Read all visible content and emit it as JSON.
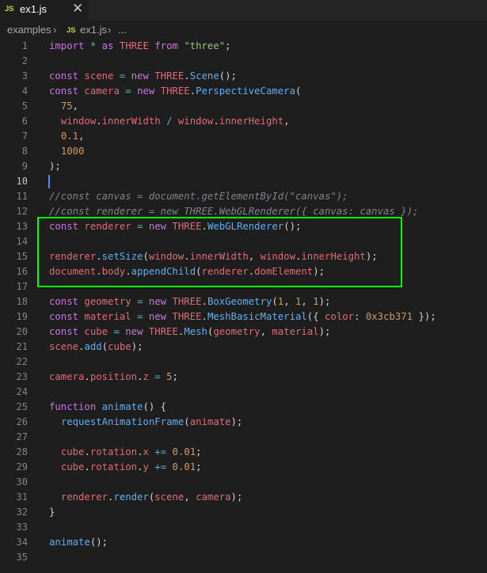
{
  "tab": {
    "icon_label": "JS",
    "filename": "ex1.js",
    "close_glyph": "✕"
  },
  "breadcrumb": {
    "folder": "examples",
    "sep": "›",
    "icon_label": "JS",
    "file": "ex1.js",
    "more": "..."
  },
  "highlight_color": "#00ff00",
  "active_line": 10,
  "lines": [
    {
      "n": "1",
      "tokens": [
        [
          "k",
          "import "
        ],
        [
          "o",
          "* "
        ],
        [
          "k",
          "as "
        ],
        [
          "v",
          "THREE "
        ],
        [
          "k",
          "from "
        ],
        [
          "s",
          "\"three\""
        ],
        [
          "p",
          ";"
        ]
      ]
    },
    {
      "n": "2",
      "tokens": []
    },
    {
      "n": "3",
      "tokens": [
        [
          "k",
          "const "
        ],
        [
          "v",
          "scene "
        ],
        [
          "o",
          "= "
        ],
        [
          "k",
          "new "
        ],
        [
          "v",
          "THREE"
        ],
        [
          "p",
          "."
        ],
        [
          "f",
          "Scene"
        ],
        [
          "p",
          "();"
        ]
      ]
    },
    {
      "n": "4",
      "tokens": [
        [
          "k",
          "const "
        ],
        [
          "v",
          "camera "
        ],
        [
          "o",
          "= "
        ],
        [
          "k",
          "new "
        ],
        [
          "v",
          "THREE"
        ],
        [
          "p",
          "."
        ],
        [
          "f",
          "PerspectiveCamera"
        ],
        [
          "p",
          "("
        ]
      ]
    },
    {
      "n": "5",
      "tokens": [
        [
          "p",
          "  "
        ],
        [
          "n",
          "75"
        ],
        [
          "p",
          ","
        ]
      ]
    },
    {
      "n": "6",
      "tokens": [
        [
          "p",
          "  "
        ],
        [
          "v",
          "window"
        ],
        [
          "p",
          "."
        ],
        [
          "v",
          "innerWidth "
        ],
        [
          "o",
          "/ "
        ],
        [
          "v",
          "window"
        ],
        [
          "p",
          "."
        ],
        [
          "v",
          "innerHeight"
        ],
        [
          "p",
          ","
        ]
      ]
    },
    {
      "n": "7",
      "tokens": [
        [
          "p",
          "  "
        ],
        [
          "n",
          "0.1"
        ],
        [
          "p",
          ","
        ]
      ]
    },
    {
      "n": "8",
      "tokens": [
        [
          "p",
          "  "
        ],
        [
          "n",
          "1000"
        ]
      ]
    },
    {
      "n": "9",
      "tokens": [
        [
          "p",
          ");"
        ]
      ]
    },
    {
      "n": "10",
      "tokens": []
    },
    {
      "n": "11",
      "tokens": [
        [
          "c",
          "//const canvas = document.getElementById(\"canvas\");"
        ]
      ]
    },
    {
      "n": "12",
      "tokens": [
        [
          "c",
          "//const renderer = new THREE.WebGLRenderer({ canvas: canvas });"
        ]
      ]
    },
    {
      "n": "13",
      "tokens": [
        [
          "k",
          "const "
        ],
        [
          "v",
          "renderer "
        ],
        [
          "o",
          "= "
        ],
        [
          "k",
          "new "
        ],
        [
          "v",
          "THREE"
        ],
        [
          "p",
          "."
        ],
        [
          "f",
          "WebGLRenderer"
        ],
        [
          "p",
          "();"
        ]
      ]
    },
    {
      "n": "14",
      "tokens": []
    },
    {
      "n": "15",
      "tokens": [
        [
          "v",
          "renderer"
        ],
        [
          "p",
          "."
        ],
        [
          "f",
          "setSize"
        ],
        [
          "p",
          "("
        ],
        [
          "v",
          "window"
        ],
        [
          "p",
          "."
        ],
        [
          "v",
          "innerWidth"
        ],
        [
          "p",
          ", "
        ],
        [
          "v",
          "window"
        ],
        [
          "p",
          "."
        ],
        [
          "v",
          "innerHeight"
        ],
        [
          "p",
          ");"
        ]
      ]
    },
    {
      "n": "16",
      "tokens": [
        [
          "v",
          "document"
        ],
        [
          "p",
          "."
        ],
        [
          "v",
          "body"
        ],
        [
          "p",
          "."
        ],
        [
          "f",
          "appendChild"
        ],
        [
          "p",
          "("
        ],
        [
          "v",
          "renderer"
        ],
        [
          "p",
          "."
        ],
        [
          "v",
          "domElement"
        ],
        [
          "p",
          ");"
        ]
      ]
    },
    {
      "n": "17",
      "tokens": []
    },
    {
      "n": "18",
      "tokens": [
        [
          "k",
          "const "
        ],
        [
          "v",
          "geometry "
        ],
        [
          "o",
          "= "
        ],
        [
          "k",
          "new "
        ],
        [
          "v",
          "THREE"
        ],
        [
          "p",
          "."
        ],
        [
          "f",
          "BoxGeometry"
        ],
        [
          "p",
          "("
        ],
        [
          "n",
          "1"
        ],
        [
          "p",
          ", "
        ],
        [
          "n",
          "1"
        ],
        [
          "p",
          ", "
        ],
        [
          "n",
          "1"
        ],
        [
          "p",
          ");"
        ]
      ]
    },
    {
      "n": "19",
      "tokens": [
        [
          "k",
          "const "
        ],
        [
          "v",
          "material "
        ],
        [
          "o",
          "= "
        ],
        [
          "k",
          "new "
        ],
        [
          "v",
          "THREE"
        ],
        [
          "p",
          "."
        ],
        [
          "f",
          "MeshBasicMaterial"
        ],
        [
          "p",
          "({ "
        ],
        [
          "v",
          "color"
        ],
        [
          "p",
          ": "
        ],
        [
          "n",
          "0x3cb371"
        ],
        [
          "p",
          " });"
        ]
      ]
    },
    {
      "n": "20",
      "tokens": [
        [
          "k",
          "const "
        ],
        [
          "v",
          "cube "
        ],
        [
          "o",
          "= "
        ],
        [
          "k",
          "new "
        ],
        [
          "v",
          "THREE"
        ],
        [
          "p",
          "."
        ],
        [
          "f",
          "Mesh"
        ],
        [
          "p",
          "("
        ],
        [
          "v",
          "geometry"
        ],
        [
          "p",
          ", "
        ],
        [
          "v",
          "material"
        ],
        [
          "p",
          ");"
        ]
      ]
    },
    {
      "n": "21",
      "tokens": [
        [
          "v",
          "scene"
        ],
        [
          "p",
          "."
        ],
        [
          "f",
          "add"
        ],
        [
          "p",
          "("
        ],
        [
          "v",
          "cube"
        ],
        [
          "p",
          ");"
        ]
      ]
    },
    {
      "n": "22",
      "tokens": []
    },
    {
      "n": "23",
      "tokens": [
        [
          "v",
          "camera"
        ],
        [
          "p",
          "."
        ],
        [
          "v",
          "position"
        ],
        [
          "p",
          "."
        ],
        [
          "v",
          "z "
        ],
        [
          "o",
          "= "
        ],
        [
          "n",
          "5"
        ],
        [
          "p",
          ";"
        ]
      ]
    },
    {
      "n": "24",
      "tokens": []
    },
    {
      "n": "25",
      "tokens": [
        [
          "k",
          "function "
        ],
        [
          "f",
          "animate"
        ],
        [
          "p",
          "() {"
        ]
      ]
    },
    {
      "n": "26",
      "tokens": [
        [
          "p",
          "  "
        ],
        [
          "f",
          "requestAnimationFrame"
        ],
        [
          "p",
          "("
        ],
        [
          "v",
          "animate"
        ],
        [
          "p",
          ");"
        ]
      ]
    },
    {
      "n": "27",
      "tokens": []
    },
    {
      "n": "28",
      "tokens": [
        [
          "p",
          "  "
        ],
        [
          "v",
          "cube"
        ],
        [
          "p",
          "."
        ],
        [
          "v",
          "rotation"
        ],
        [
          "p",
          "."
        ],
        [
          "v",
          "x "
        ],
        [
          "o",
          "+= "
        ],
        [
          "n",
          "0.01"
        ],
        [
          "p",
          ";"
        ]
      ]
    },
    {
      "n": "29",
      "tokens": [
        [
          "p",
          "  "
        ],
        [
          "v",
          "cube"
        ],
        [
          "p",
          "."
        ],
        [
          "v",
          "rotation"
        ],
        [
          "p",
          "."
        ],
        [
          "v",
          "y "
        ],
        [
          "o",
          "+= "
        ],
        [
          "n",
          "0.01"
        ],
        [
          "p",
          ";"
        ]
      ]
    },
    {
      "n": "30",
      "tokens": []
    },
    {
      "n": "31",
      "tokens": [
        [
          "p",
          "  "
        ],
        [
          "v",
          "renderer"
        ],
        [
          "p",
          "."
        ],
        [
          "f",
          "render"
        ],
        [
          "p",
          "("
        ],
        [
          "v",
          "scene"
        ],
        [
          "p",
          ", "
        ],
        [
          "v",
          "camera"
        ],
        [
          "p",
          ");"
        ]
      ]
    },
    {
      "n": "32",
      "tokens": [
        [
          "p",
          "}"
        ]
      ]
    },
    {
      "n": "33",
      "tokens": []
    },
    {
      "n": "34",
      "tokens": [
        [
          "f",
          "animate"
        ],
        [
          "p",
          "();"
        ]
      ]
    },
    {
      "n": "35",
      "tokens": []
    }
  ]
}
